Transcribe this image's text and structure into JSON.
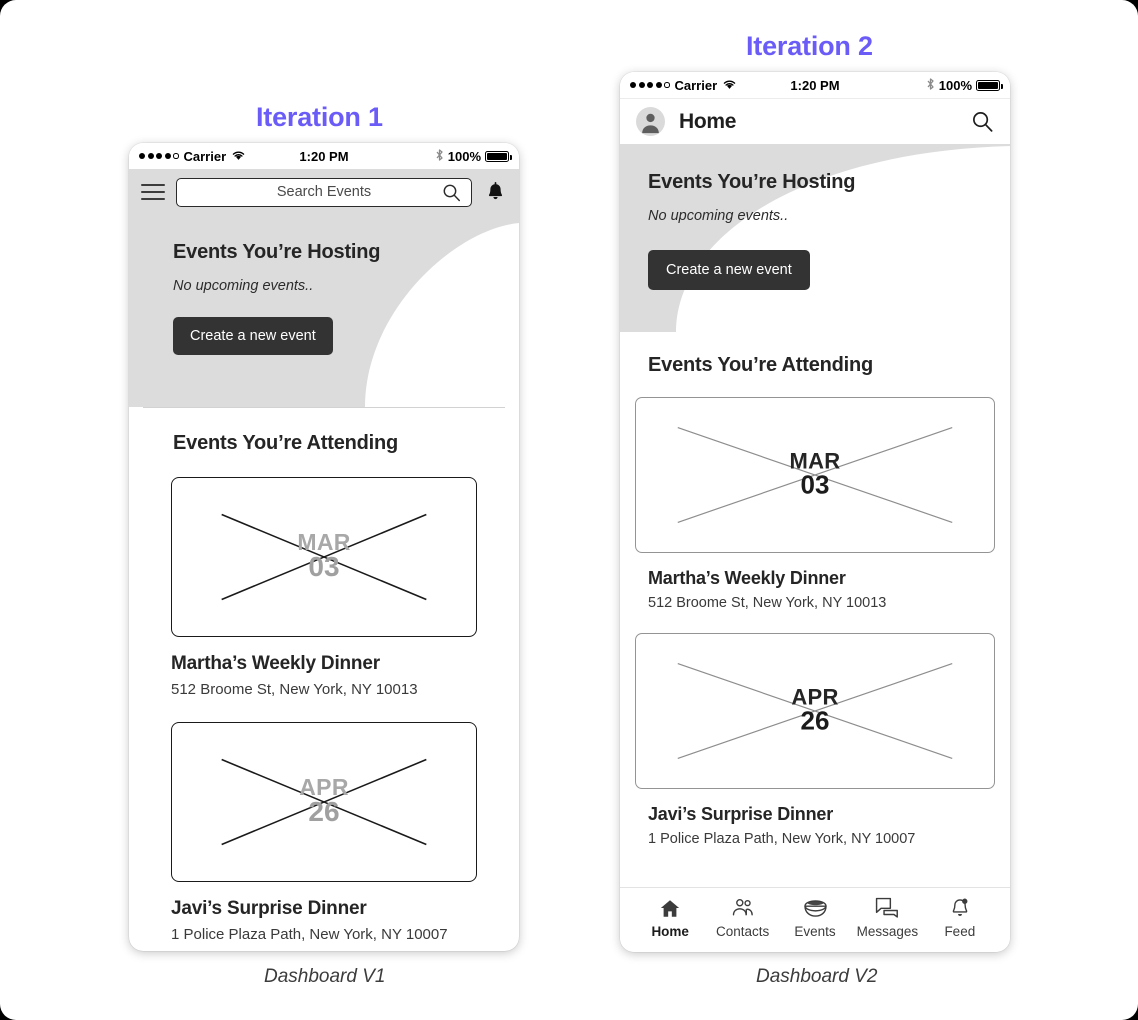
{
  "theme": {
    "accent": "#6B5CF7",
    "hero_gray": "#dcdcdc",
    "cta_dark": "#333333",
    "topbar_gray": "#dcdcdc"
  },
  "iterations": [
    {
      "title": "Iteration 1",
      "caption": "Dashboard V1"
    },
    {
      "title": "Iteration 2",
      "caption": "Dashboard V2"
    }
  ],
  "status_bar": {
    "carrier": "Carrier",
    "time": "1:20 PM",
    "battery_percent": "100%",
    "wifi_icon": "wifi-icon",
    "bluetooth_icon": "bluetooth-icon",
    "battery_icon": "battery-icon",
    "signal_dots_filled": 4,
    "signal_dots_total": 5
  },
  "v1": {
    "topbar": {
      "menu_icon": "hamburger-menu-icon",
      "search_placeholder": "Search Events",
      "search_value": "",
      "search_icon": "magnifier-icon",
      "notifications_icon": "bell-icon"
    },
    "hero": {
      "heading": "Events You’re Hosting",
      "empty_text": "No upcoming events..",
      "cta_label": "Create a new event"
    },
    "attending": {
      "heading": "Events You’re Attending",
      "events": [
        {
          "month": "MAR",
          "day": "03",
          "title": "Martha’s Weekly Dinner",
          "address": "512 Broome St, New York, NY 10013",
          "thumb_icon": "image-placeholder-cross-icon"
        },
        {
          "month": "APR",
          "day": "26",
          "title": "Javi’s Surprise Dinner",
          "address": "1 Police Plaza Path, New York, NY 10007",
          "thumb_icon": "image-placeholder-cross-icon"
        }
      ]
    }
  },
  "v2": {
    "navbar": {
      "avatar_icon": "user-avatar-icon",
      "title": "Home",
      "search_icon": "magnifier-icon"
    },
    "hero": {
      "heading": "Events You’re Hosting",
      "empty_text": "No upcoming events..",
      "cta_label": "Create a new event"
    },
    "attending": {
      "heading": "Events You’re Attending",
      "events": [
        {
          "month": "MAR",
          "day": "03",
          "title": "Martha’s Weekly Dinner",
          "address": "512 Broome St, New York, NY 10013",
          "thumb_icon": "image-placeholder-cross-icon"
        },
        {
          "month": "APR",
          "day": "26",
          "title": "Javi’s Surprise Dinner",
          "address": "1 Police Plaza Path, New York, NY 10007",
          "thumb_icon": "image-placeholder-cross-icon"
        }
      ]
    },
    "tabbar": {
      "tabs": [
        {
          "label": "Home",
          "icon": "home-icon",
          "active": true
        },
        {
          "label": "Contacts",
          "icon": "contacts-icon",
          "active": false
        },
        {
          "label": "Events",
          "icon": "bowl-icon",
          "active": false
        },
        {
          "label": "Messages",
          "icon": "chat-bubbles-icon",
          "active": false
        },
        {
          "label": "Feed",
          "icon": "bell-ring-icon",
          "active": false
        }
      ]
    }
  }
}
